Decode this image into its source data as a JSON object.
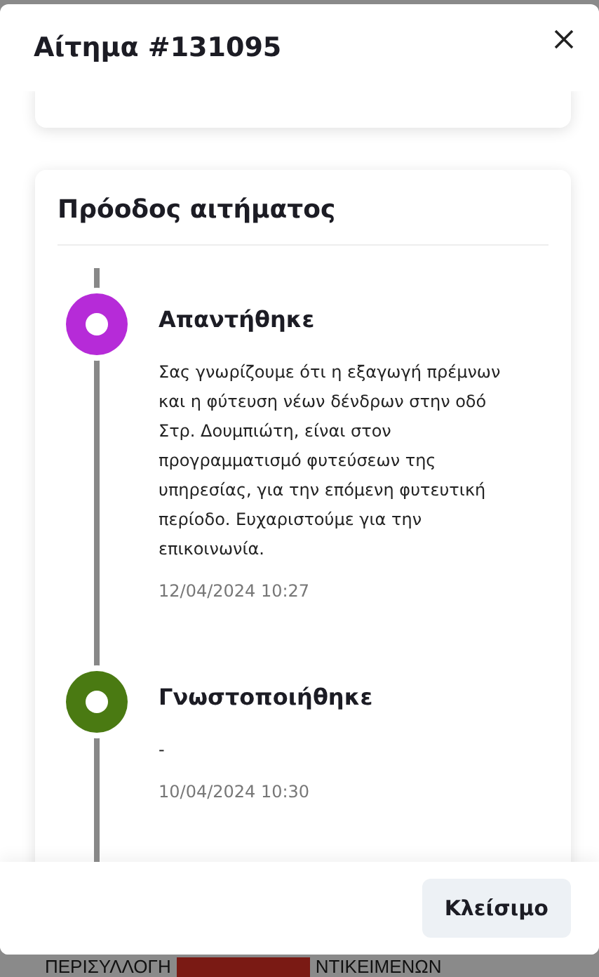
{
  "dialog": {
    "title": "Αίτημα #131095"
  },
  "progress": {
    "title": "Πρόοδος αιτήματος",
    "events": [
      {
        "status": "Απαντήθηκε",
        "color": "#b62bd8",
        "message": "Σας γνωρίζουμε ότι η εξαγωγή πρέμνων και η φύτευση νέων δένδρων στην οδό Στρ. Δουμπιώτη, είναι στον προγραμματισμό φυτεύσεων της υπηρεσίας, για την επόμενη φυτευτική περίοδο. Ευχαριστούμε για την επικοινωνία.",
        "date": "12/04/2024 10:27"
      },
      {
        "status": "Γνωστοποιήθηκε",
        "color": "#4a7a12",
        "message": "-",
        "date": "10/04/2024 10:30"
      }
    ]
  },
  "footer": {
    "close_button": "Κλείσιμο"
  },
  "background": {
    "texts": [
      "ΠΕΡΙΣΥΛΛΟΓΗ",
      "ΝΤΙΚΕΙΜΕΝΩΝ"
    ]
  }
}
